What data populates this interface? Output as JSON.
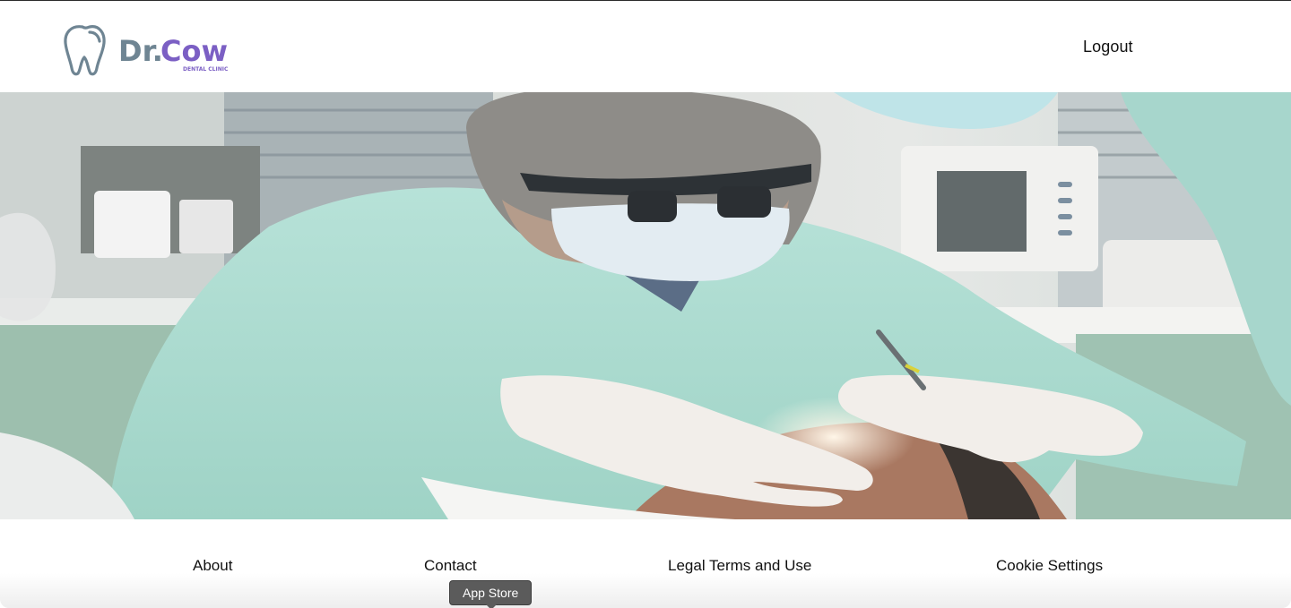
{
  "header": {
    "logo": {
      "primary_text": "Dr.Cow",
      "secondary_text": "DENTAL CLINIC",
      "icon": "tooth-icon",
      "colors": {
        "tooth": "#6f8593",
        "dr": "#6f8593",
        "cow": "#7b5fc4",
        "tagline": "#7b5fc4"
      }
    },
    "logout_label": "Logout"
  },
  "hero": {
    "image_name": "dentist-treating-patient-photo"
  },
  "footer": {
    "links": [
      "About",
      "Contact",
      "Legal Terms and Use",
      "Cookie Settings"
    ]
  },
  "tooltip": {
    "label": "App Store"
  }
}
